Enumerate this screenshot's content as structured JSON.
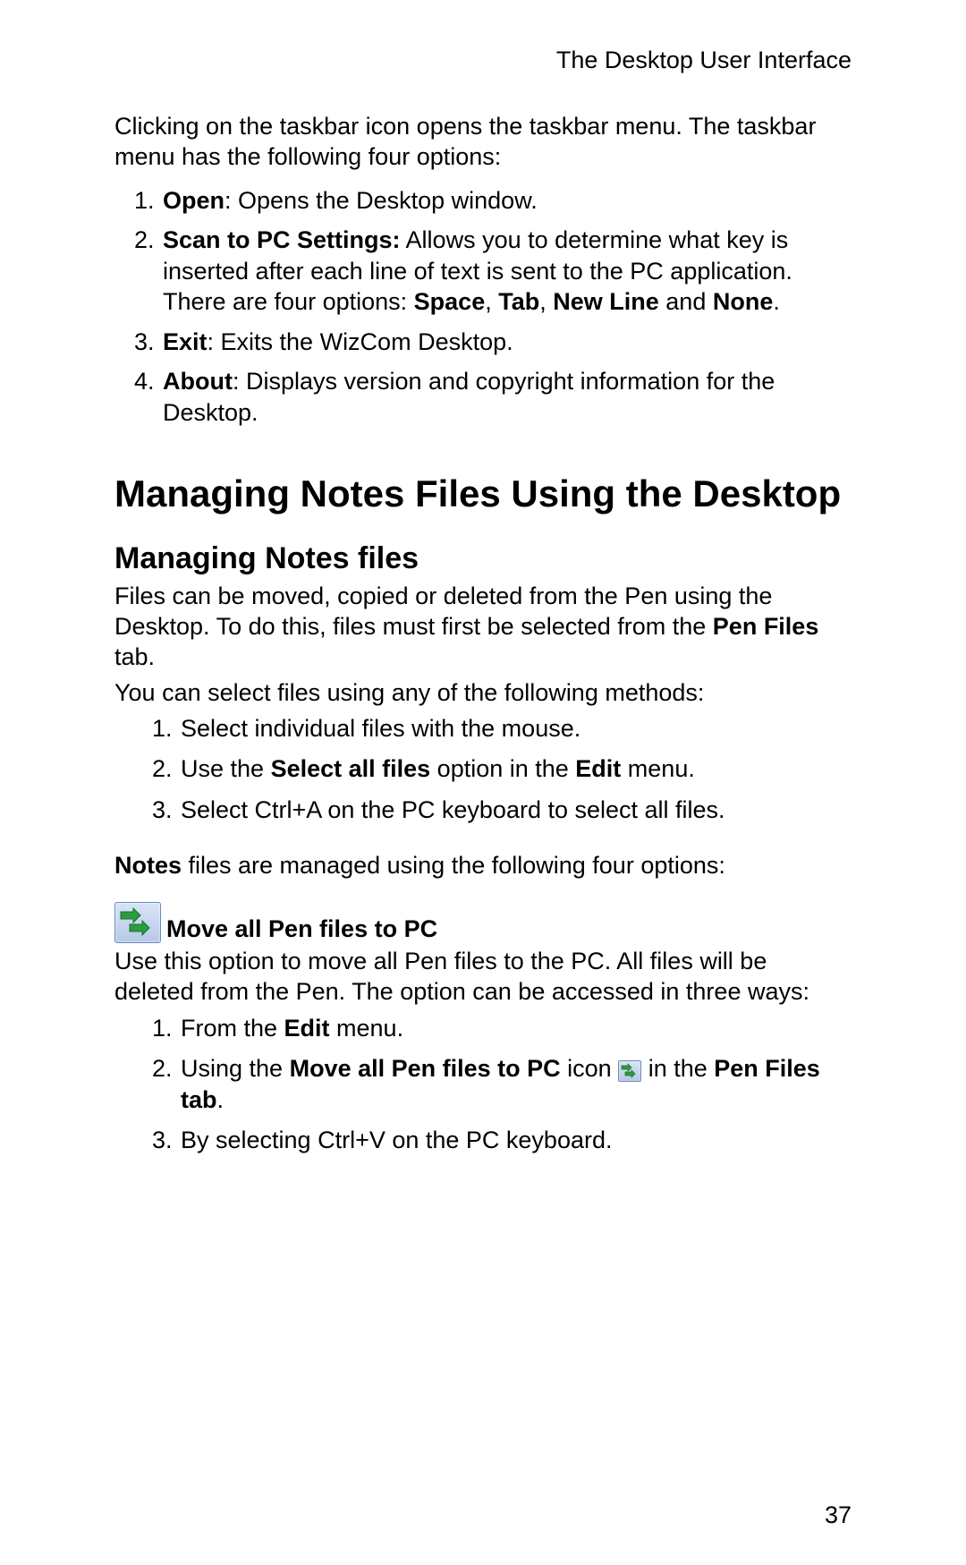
{
  "runningHead": "The Desktop User Interface",
  "intro": "Clicking on the taskbar icon opens the taskbar menu. The taskbar menu has the following four options:",
  "menuItems": {
    "open": {
      "label": "Open",
      "desc": ": Opens the Desktop window."
    },
    "scan": {
      "label": "Scan to PC Settings:",
      "desc1": " Allows you to determine what key is inserted after each line of text is sent to the PC application. There are four options: ",
      "opt1": "Space",
      "opt2": "Tab",
      "opt3": "New Line",
      "opt4": "None",
      "sep": ", ",
      "and": " and ",
      "period": "."
    },
    "exit": {
      "label": "Exit",
      "desc": ": Exits the WizCom Desktop."
    },
    "about": {
      "label": "About",
      "desc": ": Displays version and copyright information for the Desktop."
    }
  },
  "h1": "Managing Notes Files Using the Desktop",
  "h2": "Managing Notes files",
  "filesPara": {
    "t1": "Files can be moved, copied or deleted from the Pen using the Desktop. To do this, files must first be selected from the ",
    "b1": "Pen Files",
    "t2": " tab."
  },
  "selectIntro": "You can select files using any of the following methods:",
  "selectMethods": {
    "m1": "Select individual files with the mouse.",
    "m2a": "Use the ",
    "m2b": "Select all files",
    "m2c": " option in the ",
    "m2d": "Edit",
    "m2e": " menu.",
    "m3": "Select Ctrl+A on the PC keyboard to select all files."
  },
  "notesPara": {
    "b1": "Notes",
    "t1": " files are managed using the following four options:"
  },
  "moveHeading": "Move all Pen files to PC",
  "movePara": "Use this option to move all Pen files to the PC. All files will be deleted from the Pen. The option can be accessed in three ways:",
  "moveMethods": {
    "m1a": "From the ",
    "m1b": "Edit",
    "m1c": " menu.",
    "m2a": "Using the ",
    "m2b": "Move all Pen files to PC",
    "m2c": " icon ",
    "m2d": " in the ",
    "m2e": "Pen Files tab",
    "m2f": ".",
    "m3": "By selecting Ctrl+V on the PC keyboard."
  },
  "pageNumber": "37",
  "icons": {
    "moveLarge": "move-files-icon",
    "moveSmall": "move-files-icon-small"
  }
}
